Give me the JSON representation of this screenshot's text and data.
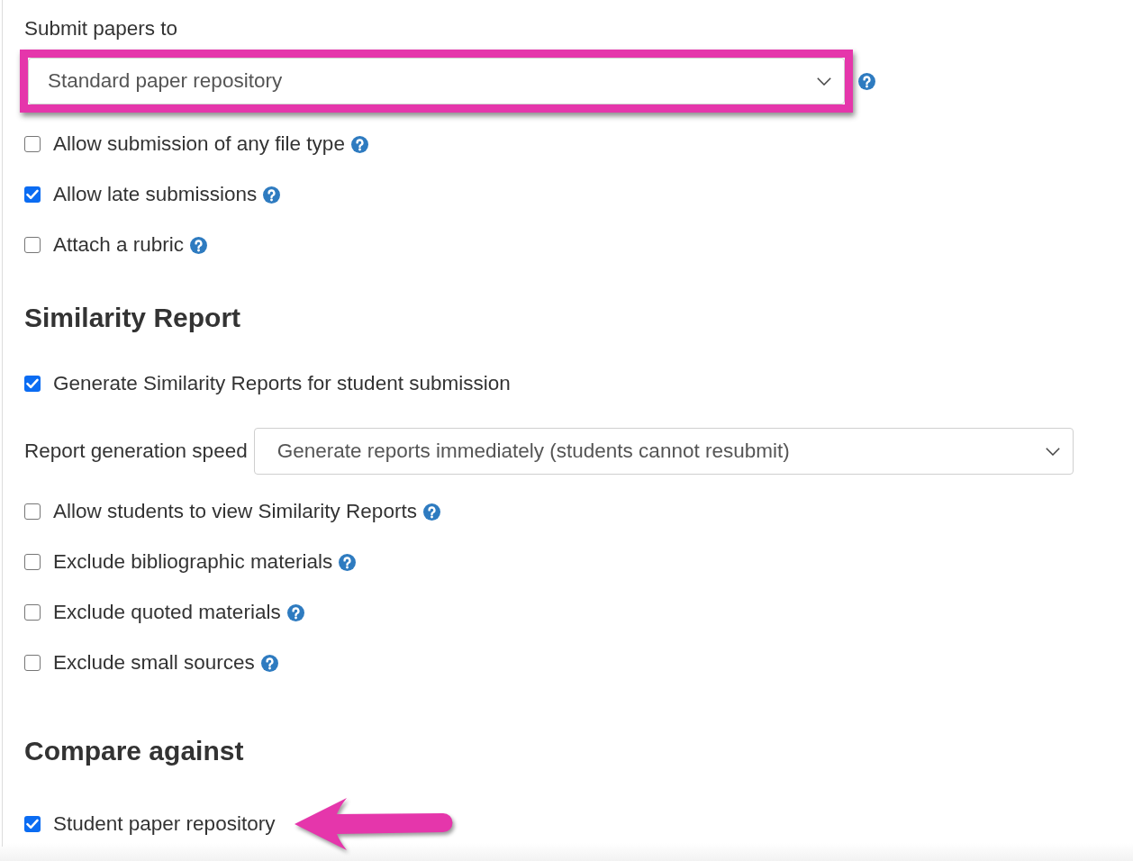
{
  "submit_papers": {
    "label": "Submit papers to",
    "value": "Standard paper repository",
    "highlighted": true,
    "help": true
  },
  "submission_options": [
    {
      "label": "Allow submission of any file type",
      "checked": false,
      "help": true
    },
    {
      "label": "Allow late submissions",
      "checked": true,
      "help": true
    },
    {
      "label": "Attach a rubric",
      "checked": false,
      "help": true
    }
  ],
  "similarity_report": {
    "title": "Similarity Report",
    "generate": {
      "label": "Generate Similarity Reports for student submission",
      "checked": true,
      "help": false
    },
    "speed": {
      "label": "Report generation speed",
      "value": "Generate reports immediately (students cannot resubmit)"
    },
    "options": [
      {
        "label": "Allow students to view Similarity Reports",
        "checked": false,
        "help": true
      },
      {
        "label": "Exclude bibliographic materials",
        "checked": false,
        "help": true
      },
      {
        "label": "Exclude quoted materials",
        "checked": false,
        "help": true
      },
      {
        "label": "Exclude small sources",
        "checked": false,
        "help": true
      }
    ]
  },
  "compare_against": {
    "title": "Compare against",
    "options": [
      {
        "label": "Student paper repository",
        "checked": true,
        "help": false,
        "pointed_at": true
      }
    ]
  }
}
